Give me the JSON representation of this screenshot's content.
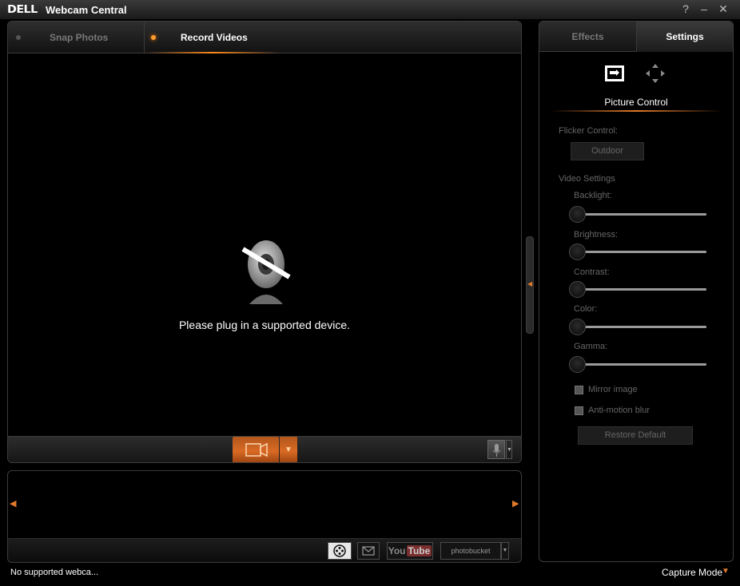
{
  "titlebar": {
    "logo": "DELL",
    "title": "Webcam Central",
    "help": "?",
    "minimize": "–",
    "close": "✕"
  },
  "main": {
    "tabs": [
      {
        "label": "Snap Photos"
      },
      {
        "label": "Record Videos"
      }
    ],
    "message": "Please plug in a supported device.",
    "record_arrow": "▼",
    "mic_arrow": "▼"
  },
  "gallery": {
    "left_arrow": "◀",
    "right_arrow": "▶",
    "share": {
      "youtube_you": "You",
      "youtube_tube": "Tube",
      "photobucket": "photobucket",
      "pb_arrow": "▼"
    }
  },
  "status": {
    "text": "No supported webca...",
    "capture_mode": "Capture Mode",
    "capture_arrow": "▼"
  },
  "settings": {
    "tabs": [
      {
        "label": "Effects"
      },
      {
        "label": "Settings"
      }
    ],
    "section_title": "Picture Control",
    "flicker_label": "Flicker Control:",
    "flicker_value": "Outdoor",
    "video_settings_label": "Video Settings",
    "sliders": [
      {
        "label": "Backlight:",
        "value": 0
      },
      {
        "label": "Brightness:",
        "value": 0
      },
      {
        "label": "Contrast:",
        "value": 0
      },
      {
        "label": "Color:",
        "value": 0
      },
      {
        "label": "Gamma:",
        "value": 0
      }
    ],
    "mirror_label": "Mirror image",
    "mirror_checked": false,
    "antiblur_label": "Anti-motion blur",
    "antiblur_checked": false,
    "restore_label": "Restore Default"
  },
  "colors": {
    "accent": "#e07a2b",
    "record_button": "#d96a24"
  }
}
